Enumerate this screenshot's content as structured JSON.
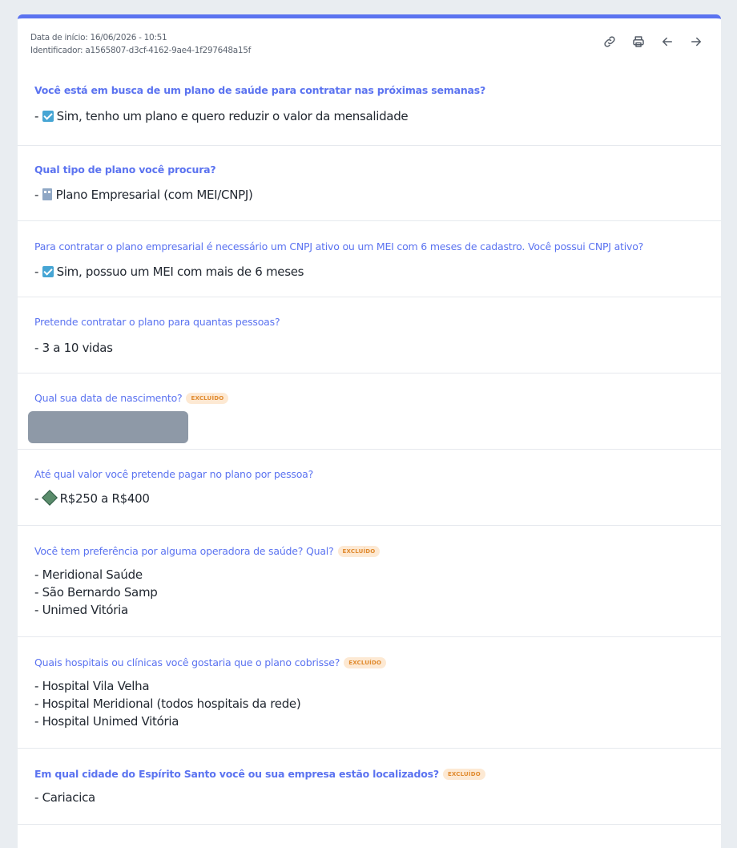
{
  "header": {
    "start_date": "Data de início: 16/06/2026 - 10:51",
    "identifier": "Identificador: a1565807-d3cf-4162-9ae4-1f297648a15f",
    "toolbar": [
      "link-icon",
      "print-icon",
      "arrow-left-icon",
      "arrow-right-icon"
    ]
  },
  "badge_label": "EXCLUÍDO",
  "colors": {
    "accent": "#5b73f0",
    "badge_text": "#e08a2e",
    "badge_bg": "#fde9d3",
    "redacted": "#8e99a7"
  },
  "questions": [
    {
      "q": "Você está em busca de um plano de saúde para contratar nas próximas semanas?",
      "a": "Sim, tenho um plano e quero reduzir o valor da mensalidade",
      "icon": "check-emoji"
    },
    {
      "q": "Qual tipo de plano você procura?",
      "a": "Plano Empresarial (com MEI/CNPJ)",
      "icon": "building-emoji"
    },
    {
      "q": "Para contratar o plano empresarial é necessário um CNPJ ativo ou um MEI com 6 meses de cadastro. Você possui CNPJ ativo?",
      "a": "Sim, possuo um MEI com mais de 6 meses",
      "icon": "check-emoji"
    },
    {
      "q": "Pretende contratar o plano para quantas pessoas?",
      "a": "- 3 a 10 vidas"
    },
    {
      "q": "Qual sua data de nascimento?"
    },
    {
      "q": "Até qual valor você pretende pagar no plano por pessoa?",
      "a": "R$250 a R$400",
      "icon": "money-emoji"
    },
    {
      "q": "Você tem preferência por alguma operadora de saúde? Qual?",
      "a": "- Meridional Saúde\n- São Bernardo Samp\n- Unimed Vitória"
    },
    {
      "q": "Quais hospitais ou clínicas você gostaria que o plano cobrisse?",
      "a": "- Hospital Vila Velha\n- Hospital Meridional (todos hospitais da rede)\n- Hospital Unimed Vitória"
    },
    {
      "q": "Em qual cidade do Espírito Santo você ou sua empresa estão localizados?",
      "a": "- Cariacica"
    }
  ]
}
